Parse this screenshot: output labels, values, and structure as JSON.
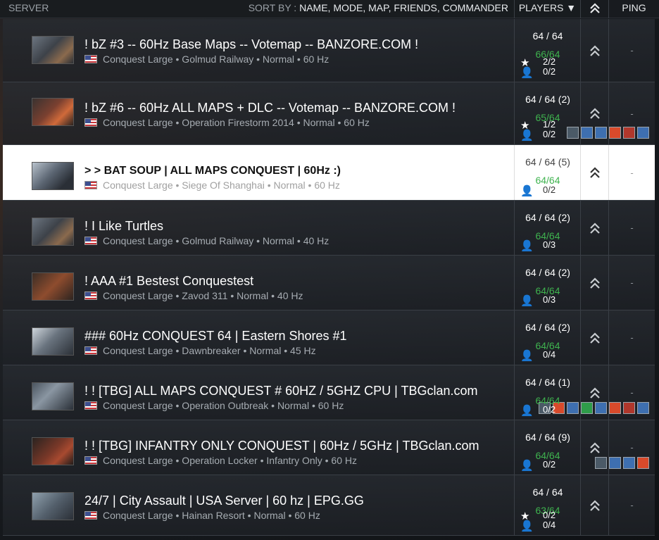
{
  "header": {
    "server": "SERVER",
    "sort_by": "SORT BY :",
    "sort_options": [
      "NAME,",
      "MODE,",
      "MAP,",
      "FRIENDS,",
      "COMMANDER"
    ],
    "players": "PLAYERS ▼",
    "ping": "PING"
  },
  "servers": [
    {
      "name": "! bZ #3 -- 60Hz Base Maps -- Votemap -- BANZORE.COM !",
      "info": "Conquest Large • Golmud Railway • Normal • 60 Hz",
      "players": "64 / 64",
      "green": "66/64",
      "slot1": "2/2",
      "slot2": "0/2",
      "ping": "-",
      "icons": []
    },
    {
      "name": "! bZ #6 -- 60Hz ALL MAPS + DLC -- Votemap -- BANZORE.COM !",
      "info": "Conquest Large • Operation Firestorm 2014 • Normal • 60 Hz",
      "players": "64 / 64 (2)",
      "green": "65/64",
      "slot1": "1/2",
      "slot2": "0/2",
      "ping": "-",
      "icons": [
        "c0",
        "c1",
        "c1",
        "c2",
        "c4",
        "c1"
      ]
    },
    {
      "name": "> > BAT SOUP | ALL MAPS CONQUEST | 60Hz :)",
      "info": "Conquest Large • Siege Of Shanghai • Normal • 60 Hz",
      "players": "64 / 64 (5)",
      "green": "64/64",
      "slot1": "",
      "slot2": "0/2",
      "ping": "-",
      "icons": []
    },
    {
      "name": "! I Like Turtles",
      "info": "Conquest Large • Golmud Railway • Normal • 40 Hz",
      "players": "64 / 64 (2)",
      "green": "64/64",
      "slot1": "",
      "slot2": "0/3",
      "ping": "-",
      "icons": []
    },
    {
      "name": "! AAA #1 Bestest Conquestest",
      "info": "Conquest Large • Zavod 311 • Normal • 40 Hz",
      "players": "64 / 64 (2)",
      "green": "64/64",
      "slot1": "",
      "slot2": "0/3",
      "ping": "-",
      "icons": []
    },
    {
      "name": "### 60Hz CONQUEST 64 | Eastern Shores #1",
      "info": "Conquest Large • Dawnbreaker • Normal • 45 Hz",
      "players": "64 / 64 (2)",
      "green": "64/64",
      "slot1": "",
      "slot2": "0/4",
      "ping": "-",
      "icons": []
    },
    {
      "name": "! ! [TBG] ALL MAPS CONQUEST # 60HZ / 5GHZ CPU | TBGclan.com",
      "info": "Conquest Large • Operation Outbreak • Normal • 60 Hz",
      "players": "64 / 64 (1)",
      "green": "64/64",
      "slot1": "",
      "slot2": "0/2",
      "ping": "-",
      "icons": [
        "c0",
        "c2",
        "c1",
        "c3",
        "c1",
        "c2",
        "c4",
        "c1"
      ]
    },
    {
      "name": "! ! [TBG] INFANTRY ONLY CONQUEST | 60Hz / 5GHz | TBGclan.com",
      "info": "Conquest Large • Operation Locker • Infantry Only • 60 Hz",
      "players": "64 / 64 (9)",
      "green": "64/64",
      "slot1": "",
      "slot2": "0/2",
      "ping": "-",
      "icons": [
        "c0",
        "c1",
        "c1",
        "c2"
      ]
    },
    {
      "name": "24/7 | City Assault | USA Server | 60 hz | EPG.GG",
      "info": "Conquest Large • Hainan Resort • Normal • 60 Hz",
      "players": "64 / 64",
      "green": "63/64",
      "slot1": "0/2",
      "slot2": "0/4",
      "ping": "-",
      "icons": []
    }
  ]
}
